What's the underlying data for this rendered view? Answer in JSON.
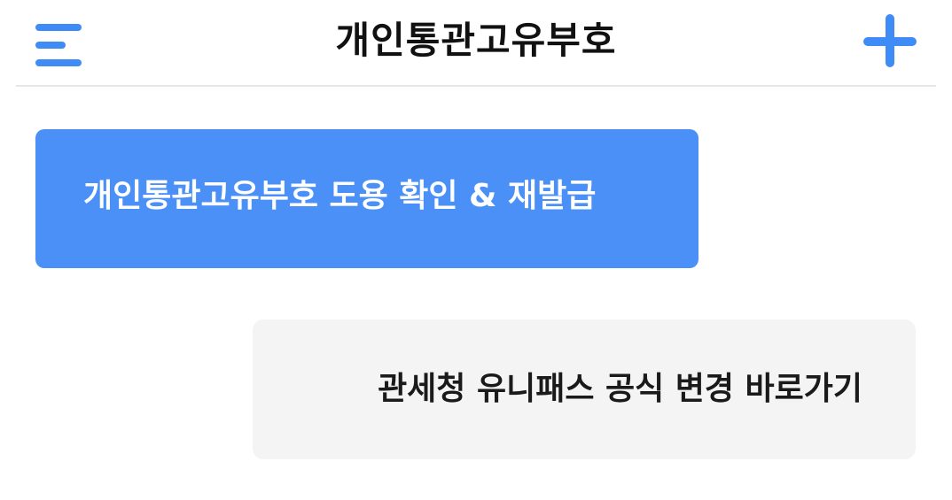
{
  "header": {
    "title": "개인통관고유부호",
    "menu_icon": "hamburger-menu-icon",
    "add_icon": "plus-icon"
  },
  "actions": {
    "primary_label": "개인통관고유부호 도용 확인 & 재발급",
    "secondary_label": "관세청 유니패스 공식 변경 바로가기"
  },
  "colors": {
    "accent": "#4a90f7",
    "icon": "#3f8cf6",
    "secondary_bg": "#f4f4f4",
    "text_dark": "#111111"
  }
}
